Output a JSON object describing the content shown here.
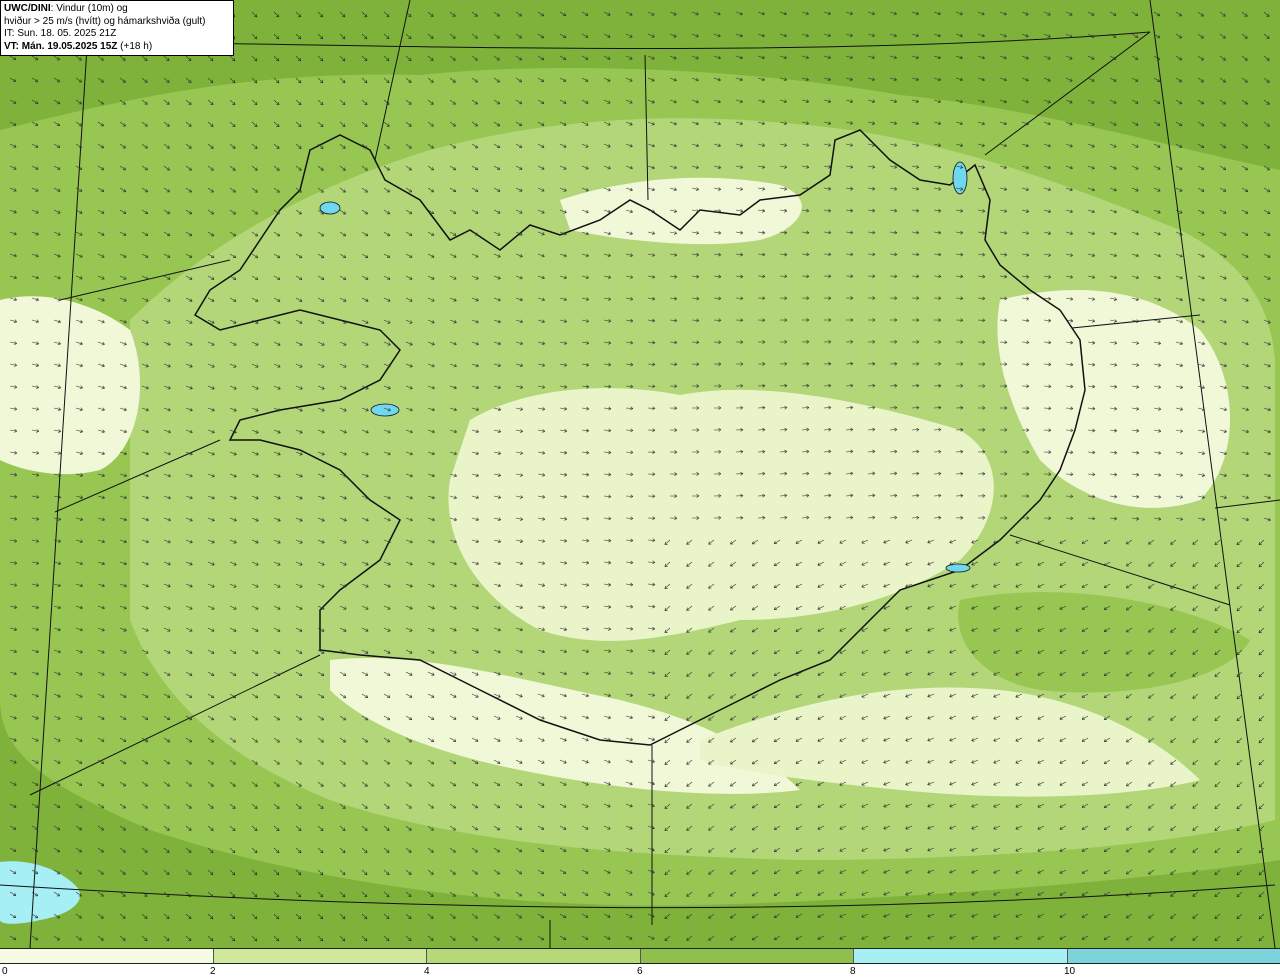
{
  "info": {
    "model": "UWC/DINI",
    "line1_rest": ": Vindur (10m) og",
    "line2": "hviður > 25 m/s (hvítt) og hámarkshviða (gult)",
    "line3": "IT: Sun. 18. 05. 2025 21Z",
    "vt_label": "VT: Mán. 19.05.2025 15Z",
    "vt_lead": " (+18 h)"
  },
  "legend": {
    "ticks": [
      "0",
      "2",
      "4",
      "6",
      "8",
      "10"
    ],
    "colors": [
      "#f6fbe4",
      "#cfe89c",
      "#b5d977",
      "#8fc04b",
      "#a6f0f5",
      "#7dd3dc"
    ]
  },
  "palette": {
    "sea_dark": "#7fb23a",
    "band_4_6": "#97c652",
    "band_2_4": "#b3d778",
    "band_0_2": "#f1f8d8",
    "lake": "#6fd8ee",
    "coast": "#111111"
  }
}
